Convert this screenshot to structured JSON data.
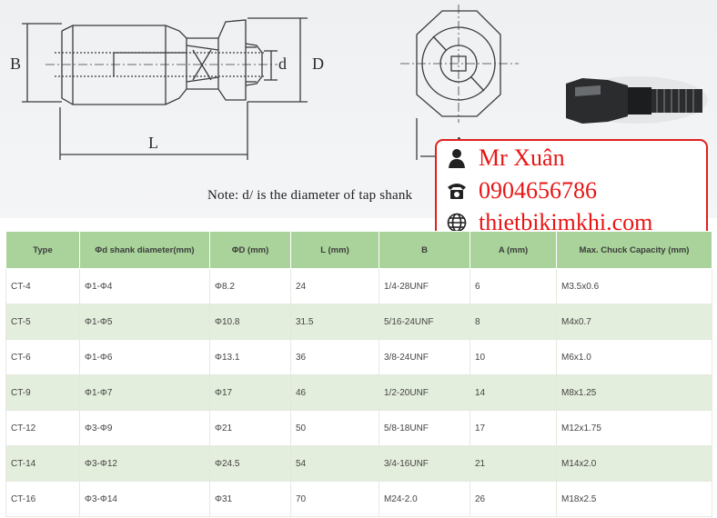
{
  "drawing": {
    "labels": {
      "B": "B",
      "L": "L",
      "d": "d",
      "D": "D",
      "A": "A"
    },
    "note": "Note: d/ is the diameter of tap shank"
  },
  "contact": {
    "name": "Mr Xuân",
    "phone": "0904656786",
    "website": "thietbikimkhi.com",
    "icons": [
      "person-icon",
      "telephone-icon",
      "globe-icon"
    ],
    "color": "#e81515"
  },
  "table": {
    "header_color": "#a9d39a",
    "stripe_color": "#e4eedc",
    "columns": [
      "Type",
      "Φd shank diameter(mm)",
      "ΦD (mm)",
      "L (mm)",
      "B",
      "A (mm)",
      "Max. Chuck Capacity (mm)"
    ],
    "rows": [
      [
        "CT-4",
        "Φ1-Φ4",
        "Φ8.2",
        "24",
        "1/4-28UNF",
        "6",
        "M3.5x0.6"
      ],
      [
        "CT-5",
        "Φ1-Φ5",
        "Φ10.8",
        "31.5",
        "5/16-24UNF",
        "8",
        "M4x0.7"
      ],
      [
        "CT-6",
        "Φ1-Φ6",
        "Φ13.1",
        "36",
        "3/8-24UNF",
        "10",
        "M6x1.0"
      ],
      [
        "CT-9",
        "Φ1-Φ7",
        "Φ17",
        "46",
        "1/2-20UNF",
        "14",
        "M8x1.25"
      ],
      [
        "CT-12",
        "Φ3-Φ9",
        "Φ21",
        "50",
        "5/8-18UNF",
        "17",
        "M12x1.75"
      ],
      [
        "CT-14",
        "Φ3-Φ12",
        "Φ24.5",
        "54",
        "3/4-16UNF",
        "21",
        "M14x2.0"
      ],
      [
        "CT-16",
        "Φ3-Φ14",
        "Φ31",
        "70",
        "M24-2.0",
        "26",
        "M18x2.5"
      ]
    ]
  }
}
